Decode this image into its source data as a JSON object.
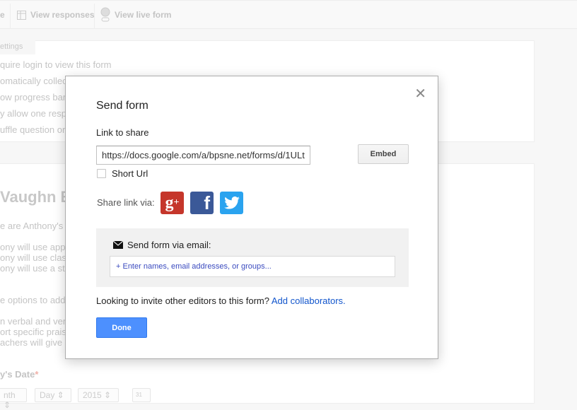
{
  "toolbar": {
    "partial_item": "e",
    "view_responses": "View responses",
    "view_live_form": "View live form"
  },
  "settings": {
    "tab": "ettings",
    "items": [
      "quire login to view this form",
      "omatically collec",
      "ow progress bar",
      "y allow one resp",
      "uffle question ord"
    ]
  },
  "form": {
    "title": "Vaughn B",
    "description": "e are Anthony's t",
    "lines": [
      "ony will use appr",
      "ony will use class",
      "ony will use a stu",
      "e options to addr",
      "n verbal and ver",
      "ort specific prais",
      "achers will give p"
    ],
    "date_label": "y's Date",
    "required_mark": "*",
    "month": "nth",
    "day": "Day",
    "year": "2015",
    "calendar_day": "31"
  },
  "dialog": {
    "title": "Send form",
    "link_label": "Link to share",
    "link_value": "https://docs.google.com/a/bpsne.net/forms/d/1ULt",
    "embed_label": "Embed",
    "short_url_label": "Short Url",
    "short_url_checked": false,
    "share_via_label": "Share link via:",
    "social": [
      {
        "icon": "google-plus-icon",
        "color": "#c5362b"
      },
      {
        "icon": "facebook-icon",
        "color": "#3b5998"
      },
      {
        "icon": "twitter-icon",
        "color": "#2aa3ef"
      }
    ],
    "email_label": "Send form via email:",
    "email_placeholder": "+ Enter names, email addresses, or groups...",
    "invite_text": "Looking to invite other editors to this form?",
    "invite_link": "Add collaborators.",
    "done_label": "Done",
    "close": "✕"
  }
}
